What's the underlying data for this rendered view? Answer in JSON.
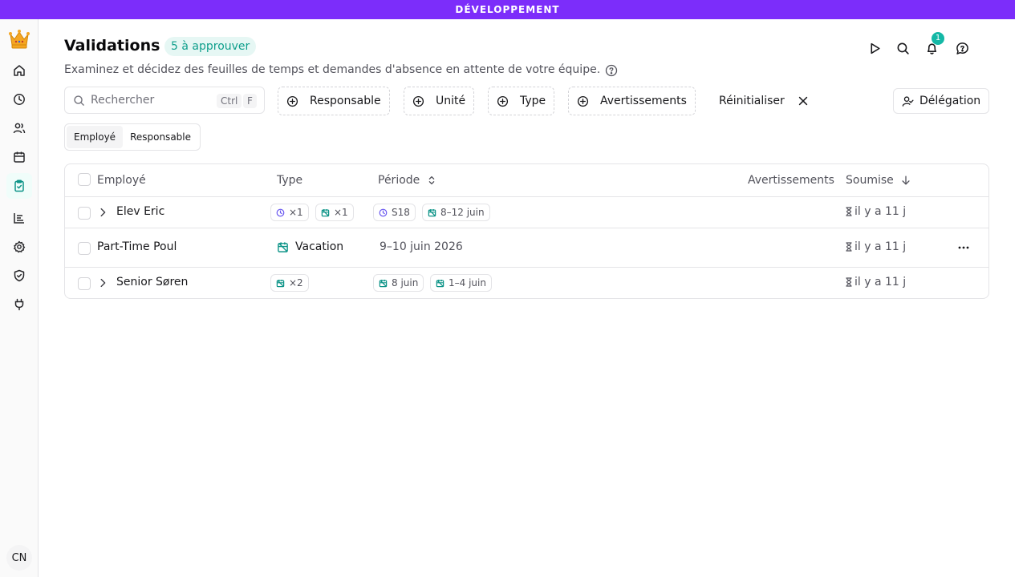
{
  "env_banner": "DÉVELOPPEMENT",
  "sidebar": {
    "items": [
      {
        "name": "home-icon"
      },
      {
        "name": "clock-icon"
      },
      {
        "name": "users-icon"
      },
      {
        "name": "calendar-icon"
      },
      {
        "name": "clipboard-check-icon",
        "active": true
      },
      {
        "name": "chart-icon"
      },
      {
        "name": "settings-icon"
      },
      {
        "name": "shield-icon"
      },
      {
        "name": "plug-icon"
      }
    ],
    "avatar": "CN"
  },
  "header": {
    "title": "Validations",
    "count_badge": "5 à approuver",
    "subtitle": "Examinez et décidez des feuilles de temps et demandes d'absence en attente de votre équipe.",
    "notification_count": "1"
  },
  "filters": {
    "search_placeholder": "Rechercher",
    "shortcut_ctrl": "Ctrl",
    "shortcut_key": "F",
    "responsable": "Responsable",
    "unite": "Unité",
    "type": "Type",
    "avertissements": "Avertissements",
    "reset": "Réinitialiser",
    "delegation": "Délégation"
  },
  "view_toggle": {
    "options": [
      "Employé",
      "Responsable"
    ],
    "selected": "Employé"
  },
  "table": {
    "columns": {
      "employee": "Employé",
      "type": "Type",
      "period": "Période",
      "warnings": "Avertissements",
      "submitted": "Soumise"
    },
    "rows": [
      {
        "employee": "Elev Eric",
        "expandable": true,
        "type_chips": [
          "×1",
          "×1"
        ],
        "period_chips": [
          "S18",
          "8–12 juin"
        ],
        "submitted": "il y a 11 j"
      },
      {
        "employee": "Part-Time Poul",
        "expandable": false,
        "type_label": "Vacation",
        "period": "9–10 juin 2026",
        "submitted": "il y a 11 j"
      },
      {
        "employee": "Senior Søren",
        "expandable": true,
        "type_chips": [
          "×2"
        ],
        "period_chips": [
          "8 juin",
          "1–4 juin"
        ],
        "submitted": "il y a 11 j"
      }
    ]
  },
  "colors": {
    "banner": "#7c2dfa",
    "accent": "#0d9488",
    "timesheet": "#6d5cf0"
  }
}
